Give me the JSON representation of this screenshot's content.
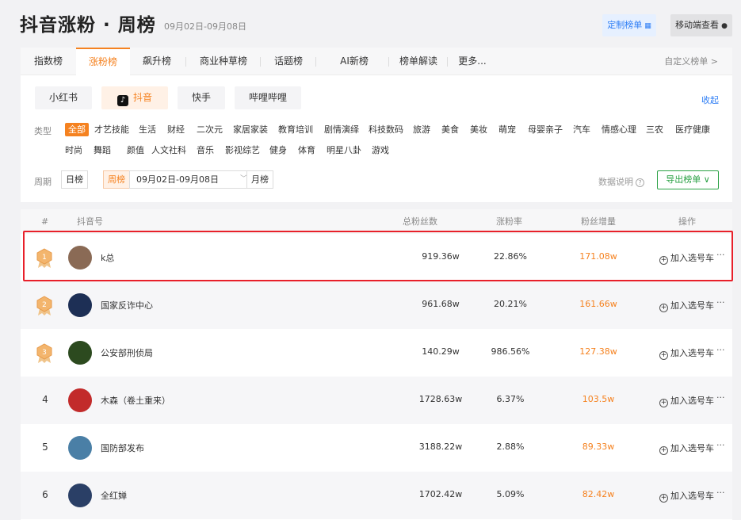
{
  "header": {
    "title": "抖音涨粉 · 周榜",
    "date_range": "09月02日-09月08日",
    "custom_btn": "定制榜单",
    "mobile_btn": "移动端查看"
  },
  "nav": {
    "tabs": [
      "指数榜",
      "涨粉榜",
      "飙升榜",
      "商业种草榜",
      "话题榜",
      "AI新榜",
      "榜单解读",
      "更多..."
    ],
    "active": "涨粉榜",
    "right_link": "自定义榜单 >"
  },
  "platforms": {
    "items": [
      "小红书",
      "抖音",
      "快手",
      "哔哩哔哩"
    ],
    "active": "抖音",
    "collapse": "收起"
  },
  "categories": {
    "label": "类型",
    "row1": [
      "全部",
      "才艺技能",
      "生活",
      "财经",
      "二次元",
      "家居家装",
      "教育培训",
      "剧情演绎",
      "科技数码",
      "旅游",
      "美食",
      "美妆",
      "萌宠",
      "母婴亲子",
      "汽车",
      "情感心理",
      "三农",
      "医疗健康"
    ],
    "row2": [
      "时尚",
      "舞蹈",
      "颜值",
      "人文社科",
      "音乐",
      "影视综艺",
      "健身",
      "体育",
      "明星八卦",
      "游戏"
    ],
    "active": "全部"
  },
  "period": {
    "label": "周期",
    "day": "日榜",
    "week": "周榜",
    "week_range": "09月02日-09月08日",
    "month": "月榜",
    "data_help": "数据说明",
    "export": "导出榜单"
  },
  "table": {
    "headers": {
      "rank": "#",
      "account": "抖音号",
      "total_fans": "总粉丝数",
      "growth_rate": "涨粉率",
      "fans_increase": "粉丝增量",
      "action": "操作"
    },
    "action_label": "加入选号车",
    "rows": [
      {
        "rank": "1",
        "name": "k总",
        "total_fans": "919.36w",
        "growth_rate": "22.86%",
        "increase": "171.08w"
      },
      {
        "rank": "2",
        "name": "国家反诈中心",
        "total_fans": "961.68w",
        "growth_rate": "20.21%",
        "increase": "161.66w"
      },
      {
        "rank": "3",
        "name": "公安部刑侦局",
        "total_fans": "140.29w",
        "growth_rate": "986.56%",
        "increase": "127.38w"
      },
      {
        "rank": "4",
        "name": "木森（卷土重来）",
        "total_fans": "1728.63w",
        "growth_rate": "6.37%",
        "increase": "103.5w"
      },
      {
        "rank": "5",
        "name": "国防部发布",
        "total_fans": "3188.22w",
        "growth_rate": "2.88%",
        "increase": "89.33w"
      },
      {
        "rank": "6",
        "name": "全红婵",
        "total_fans": "1702.42w",
        "growth_rate": "5.09%",
        "increase": "82.42w"
      }
    ]
  },
  "colors": {
    "accent": "#f58220",
    "link": "#2f7ef5",
    "export": "#2aa144",
    "highlight": "#e8202a"
  }
}
